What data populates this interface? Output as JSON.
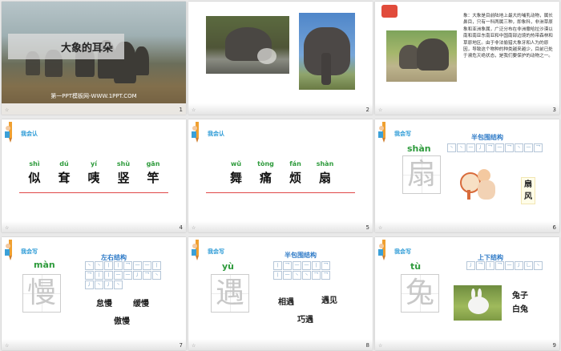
{
  "slides": [
    {
      "num": "1",
      "title": "大象的耳朵",
      "footer": "第一PPT模板网-WWW.1PPT.COM"
    },
    {
      "num": "2"
    },
    {
      "num": "3",
      "text": "象：大象是目前陆地上最大的哺乳动物，属长鼻目，只有一科两属三种，即象科，非洲草原象和亚洲象属，广泛分布在非洲撒哈拉沙漠以南和南亚东南亚和中国南部边境的热带森林和草原地区。由于非法偷猎大象牙和人为的原因，导致这个物种的种类越来越少，目前已处于濒危灭绝状态，是我们要保护的动物之一。"
    },
    {
      "num": "4",
      "label": "我会认",
      "pinyin": [
        "shì",
        "dú",
        "yí",
        "shù",
        "gān"
      ],
      "hanzi": [
        "似",
        "耷",
        "咦",
        "竖",
        "竿"
      ]
    },
    {
      "num": "5",
      "label": "我会认",
      "pinyin": [
        "wǔ",
        "tòng",
        "fán",
        "shàn"
      ],
      "hanzi": [
        "舞",
        "痛",
        "烦",
        "扇"
      ]
    },
    {
      "num": "6",
      "label": "我会写",
      "structure": "半包围结构",
      "pinyin": "shàn",
      "char": "扇",
      "strokes": [
        "丶",
        "丶",
        "一",
        "丿",
        "乛",
        "一",
        "乛",
        "丶",
        "一",
        "乛"
      ],
      "words": [
        "扇",
        "风"
      ]
    },
    {
      "num": "7",
      "label": "我会写",
      "structure": "左右结构",
      "pinyin": "màn",
      "char": "慢",
      "strokes": [
        "丶",
        "丶",
        "丨",
        "丨",
        "乛",
        "一",
        "一",
        "丨",
        "乛",
        "丨",
        "丨",
        "一",
        "一",
        "丿",
        "乛",
        "丶",
        "丿",
        "丶",
        "丿",
        "丶"
      ],
      "words": [
        "怠慢",
        "缓慢",
        "傲慢"
      ]
    },
    {
      "num": "8",
      "label": "我会写",
      "structure": "半包围结构",
      "pinyin": "yù",
      "char": "遇",
      "strokes": [
        "丨",
        "乛",
        "一",
        "一",
        "丨",
        "乛",
        "丨",
        "一",
        "丶",
        "丶",
        "乛",
        "乛"
      ],
      "words": [
        "相遇",
        "遇见",
        "巧遇"
      ]
    },
    {
      "num": "9",
      "label": "我会写",
      "structure": "上下结构",
      "pinyin": "tù",
      "char": "兔",
      "strokes": [
        "丿",
        "乛",
        "丨",
        "乛",
        "一",
        "丿",
        "乚",
        "丶"
      ],
      "words": [
        "兔子",
        "白兔"
      ]
    }
  ],
  "colors": {
    "pinyin": "#2e9b3c",
    "label": "#2b9ad6",
    "structure": "#2b78c6"
  }
}
